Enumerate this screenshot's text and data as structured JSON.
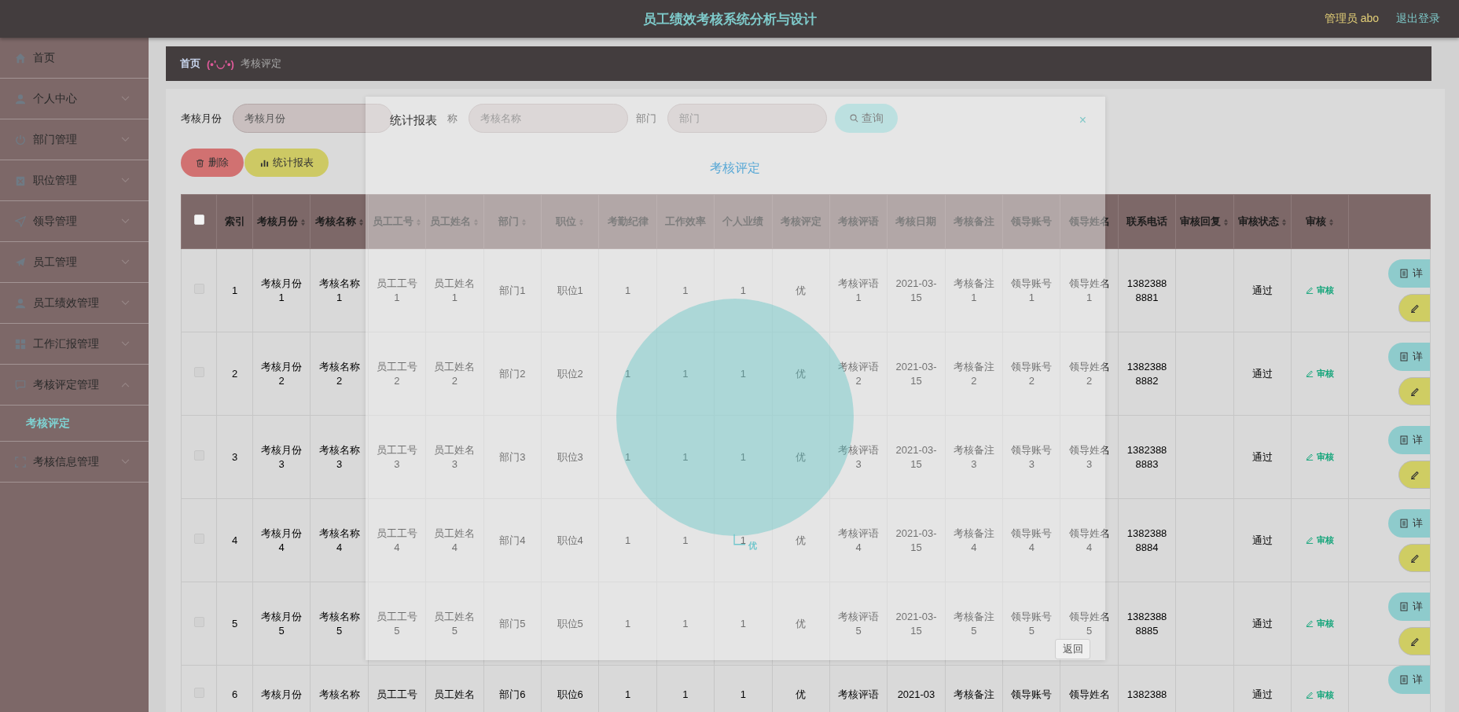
{
  "header": {
    "title": "员工绩效考核系统分析与设计",
    "user": "管理员 abo",
    "logout": "退出登录"
  },
  "sidebar": {
    "items": [
      {
        "label": "首页",
        "kind": "link"
      },
      {
        "label": "个人中心",
        "kind": "menu",
        "expanded": false
      },
      {
        "label": "部门管理",
        "kind": "menu",
        "expanded": false
      },
      {
        "label": "职位管理",
        "kind": "menu",
        "expanded": false
      },
      {
        "label": "领导管理",
        "kind": "menu",
        "expanded": false
      },
      {
        "label": "员工管理",
        "kind": "menu",
        "expanded": false
      },
      {
        "label": "员工绩效管理",
        "kind": "menu",
        "expanded": false
      },
      {
        "label": "工作汇报管理",
        "kind": "menu",
        "expanded": false
      },
      {
        "label": "考核评定管理",
        "kind": "menu",
        "expanded": true,
        "children": [
          {
            "label": "考核评定",
            "selected": true
          }
        ]
      },
      {
        "label": "考核信息管理",
        "kind": "menu",
        "expanded": false
      }
    ]
  },
  "breadcrumb": {
    "home": "首页",
    "emoticon": "(•'◡'•)",
    "current": "考核评定"
  },
  "search": {
    "fields": [
      {
        "label": "考核月份",
        "placeholder": "考核月份"
      },
      {
        "label": "称",
        "placeholder": "考核名称"
      },
      {
        "label": "部门",
        "placeholder": "部门"
      }
    ],
    "button": "查询"
  },
  "actions": [
    {
      "label": "删除",
      "kind": "delete"
    },
    {
      "label": "统计报表",
      "kind": "report"
    }
  ],
  "table": {
    "select_all": {
      "checked": false
    },
    "columns": [
      {
        "label": "索引",
        "sortable": false
      },
      {
        "label": "考核月份",
        "sortable": true
      },
      {
        "label": "考核名称",
        "sortable": true
      },
      {
        "label": "员工工号",
        "sortable": true
      },
      {
        "label": "员工姓名",
        "sortable": true
      },
      {
        "label": "部门",
        "sortable": true
      },
      {
        "label": "职位",
        "sortable": true
      },
      {
        "label": "考勤纪律",
        "sortable": false
      },
      {
        "label": "工作效率",
        "sortable": false
      },
      {
        "label": "个人业绩",
        "sortable": false
      },
      {
        "label": "考核评定",
        "sortable": false
      },
      {
        "label": "考核评语",
        "sortable": false
      },
      {
        "label": "考核日期",
        "sortable": false
      },
      {
        "label": "考核备注",
        "sortable": false
      },
      {
        "label": "领导账号",
        "sortable": false
      },
      {
        "label": "领导姓名",
        "sortable": false
      },
      {
        "label": "联系电话",
        "sortable": false
      },
      {
        "label": "审核回复",
        "sortable": true
      },
      {
        "label": "审核状态",
        "sortable": true
      },
      {
        "label": "审核",
        "sortable": true
      }
    ],
    "rows": [
      {
        "checked": false,
        "cut": false,
        "cells": [
          "1",
          "考核月份1",
          "考核名称1",
          "员工工号1",
          "员工姓名1",
          "部门1",
          "职位1",
          "1",
          "1",
          "1",
          "优",
          "考核评语1",
          "2021-03-15",
          "考核备注1",
          "领导账号1",
          "领导姓名1",
          "13823888881",
          null,
          "通过"
        ],
        "audit": "审核",
        "buttons": [
          {
            "kind": "detail",
            "label": "详"
          },
          {
            "kind": "edit"
          }
        ]
      },
      {
        "checked": false,
        "cut": false,
        "cells": [
          "2",
          "考核月份2",
          "考核名称2",
          "员工工号2",
          "员工姓名2",
          "部门2",
          "职位2",
          "1",
          "1",
          "1",
          "优",
          "考核评语2",
          "2021-03-15",
          "考核备注2",
          "领导账号2",
          "领导姓名2",
          "13823888882",
          null,
          "通过"
        ],
        "audit": "审核",
        "buttons": [
          {
            "kind": "detail",
            "label": "详"
          },
          {
            "kind": "edit"
          }
        ]
      },
      {
        "checked": false,
        "cut": false,
        "cells": [
          "3",
          "考核月份3",
          "考核名称3",
          "员工工号3",
          "员工姓名3",
          "部门3",
          "职位3",
          "1",
          "1",
          "1",
          "优",
          "考核评语3",
          "2021-03-15",
          "考核备注3",
          "领导账号3",
          "领导姓名3",
          "13823888883",
          null,
          "通过"
        ],
        "audit": "审核",
        "buttons": [
          {
            "kind": "detail",
            "label": "详"
          },
          {
            "kind": "edit"
          }
        ]
      },
      {
        "checked": false,
        "cut": false,
        "cells": [
          "4",
          "考核月份4",
          "考核名称4",
          "员工工号4",
          "员工姓名4",
          "部门4",
          "职位4",
          "1",
          "1",
          "1",
          "优",
          "考核评语4",
          "2021-03-15",
          "考核备注4",
          "领导账号4",
          "领导姓名4",
          "13823888884",
          null,
          "通过"
        ],
        "audit": "审核",
        "buttons": [
          {
            "kind": "detail",
            "label": "详"
          },
          {
            "kind": "edit"
          }
        ]
      },
      {
        "checked": false,
        "cut": false,
        "cells": [
          "5",
          "考核月份5",
          "考核名称5",
          "员工工号5",
          "员工姓名5",
          "部门5",
          "职位5",
          "1",
          "1",
          "1",
          "优",
          "考核评语5",
          "2021-03-15",
          "考核备注5",
          "领导账号5",
          "领导姓名5",
          "13823888885",
          null,
          "通过"
        ],
        "audit": "审核",
        "buttons": [
          {
            "kind": "detail",
            "label": "详"
          },
          {
            "kind": "edit"
          }
        ]
      },
      {
        "checked": false,
        "cut": true,
        "cells": [
          "6",
          "考核月份",
          "考核名称",
          "员工工号",
          "员工姓名",
          "部门6",
          "职位6",
          "1",
          "1",
          "1",
          "优",
          "考核评语",
          "2021-03",
          "考核备注",
          "领导账号",
          "领导姓名",
          "1382388",
          null,
          "通过"
        ],
        "audit": "审核",
        "buttons": [
          {
            "kind": "detail",
            "label": "详"
          }
        ]
      }
    ]
  },
  "dialog": {
    "title": "统计报表",
    "close": "×",
    "back": "返回",
    "chart_title": "考核评定",
    "slice_label": "优"
  }
}
